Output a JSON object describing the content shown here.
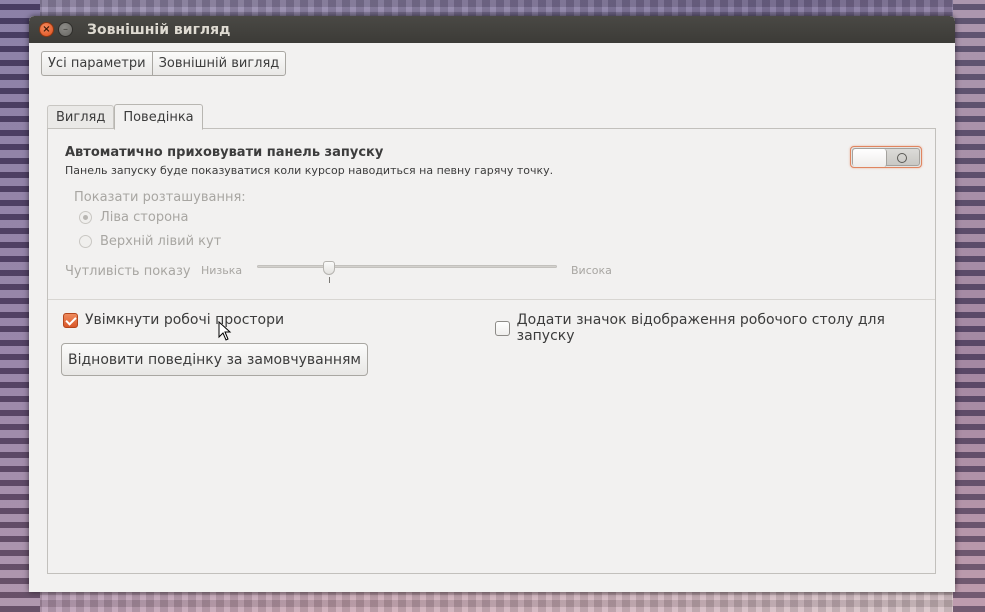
{
  "window": {
    "title": "Зовнішній вигляд"
  },
  "breadcrumb": {
    "items": [
      "Усі параметри",
      "Зовнішній вигляд"
    ]
  },
  "tabs": [
    {
      "label": "Вигляд",
      "active": false
    },
    {
      "label": "Поведінка",
      "active": true
    }
  ],
  "autohide": {
    "heading": "Автоматично приховувати панель запуску",
    "description": "Панель запуску буде показуватися коли курсор наводиться на певну гарячу точку.",
    "enabled": false
  },
  "reveal": {
    "label": "Показати розташування:",
    "options": [
      {
        "label": "Ліва сторона",
        "selected": true
      },
      {
        "label": "Верхній лівий кут",
        "selected": false
      }
    ]
  },
  "sensitivity": {
    "label": "Чутливість показу",
    "low_label": "Низька",
    "high_label": "Висока",
    "value": 0.24
  },
  "workspaces": {
    "label": "Увімкнути робочі простори",
    "checked": true
  },
  "show_desktop": {
    "label": "Додати значок відображення робочого столу для запуску",
    "checked": false
  },
  "reset_button": {
    "label": "Відновити поведінку за замовчуванням"
  },
  "colors": {
    "accent": "#dd4814",
    "window_bg": "#f2f1f0",
    "titlebar": "#3c3b37"
  }
}
